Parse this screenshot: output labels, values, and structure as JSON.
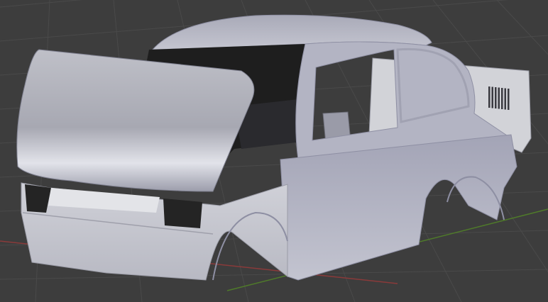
{
  "app": {
    "name": "",
    "view": "3D Viewport"
  },
  "viewport": {
    "background_color": "#3d3d3d",
    "grid_color": "#4a4a4a",
    "x_axis_color": "#8a3a3a",
    "y_axis_color": "#4f7a2a",
    "grid_visible": true
  },
  "model": {
    "object": "car-body-shell",
    "material_color": "#b7b8c4",
    "shadow_color": "#8e8fa3",
    "highlight_color": "#e6e7ee",
    "interior_color": "#1e1e1e",
    "panel_color": "#d2d3d8"
  }
}
